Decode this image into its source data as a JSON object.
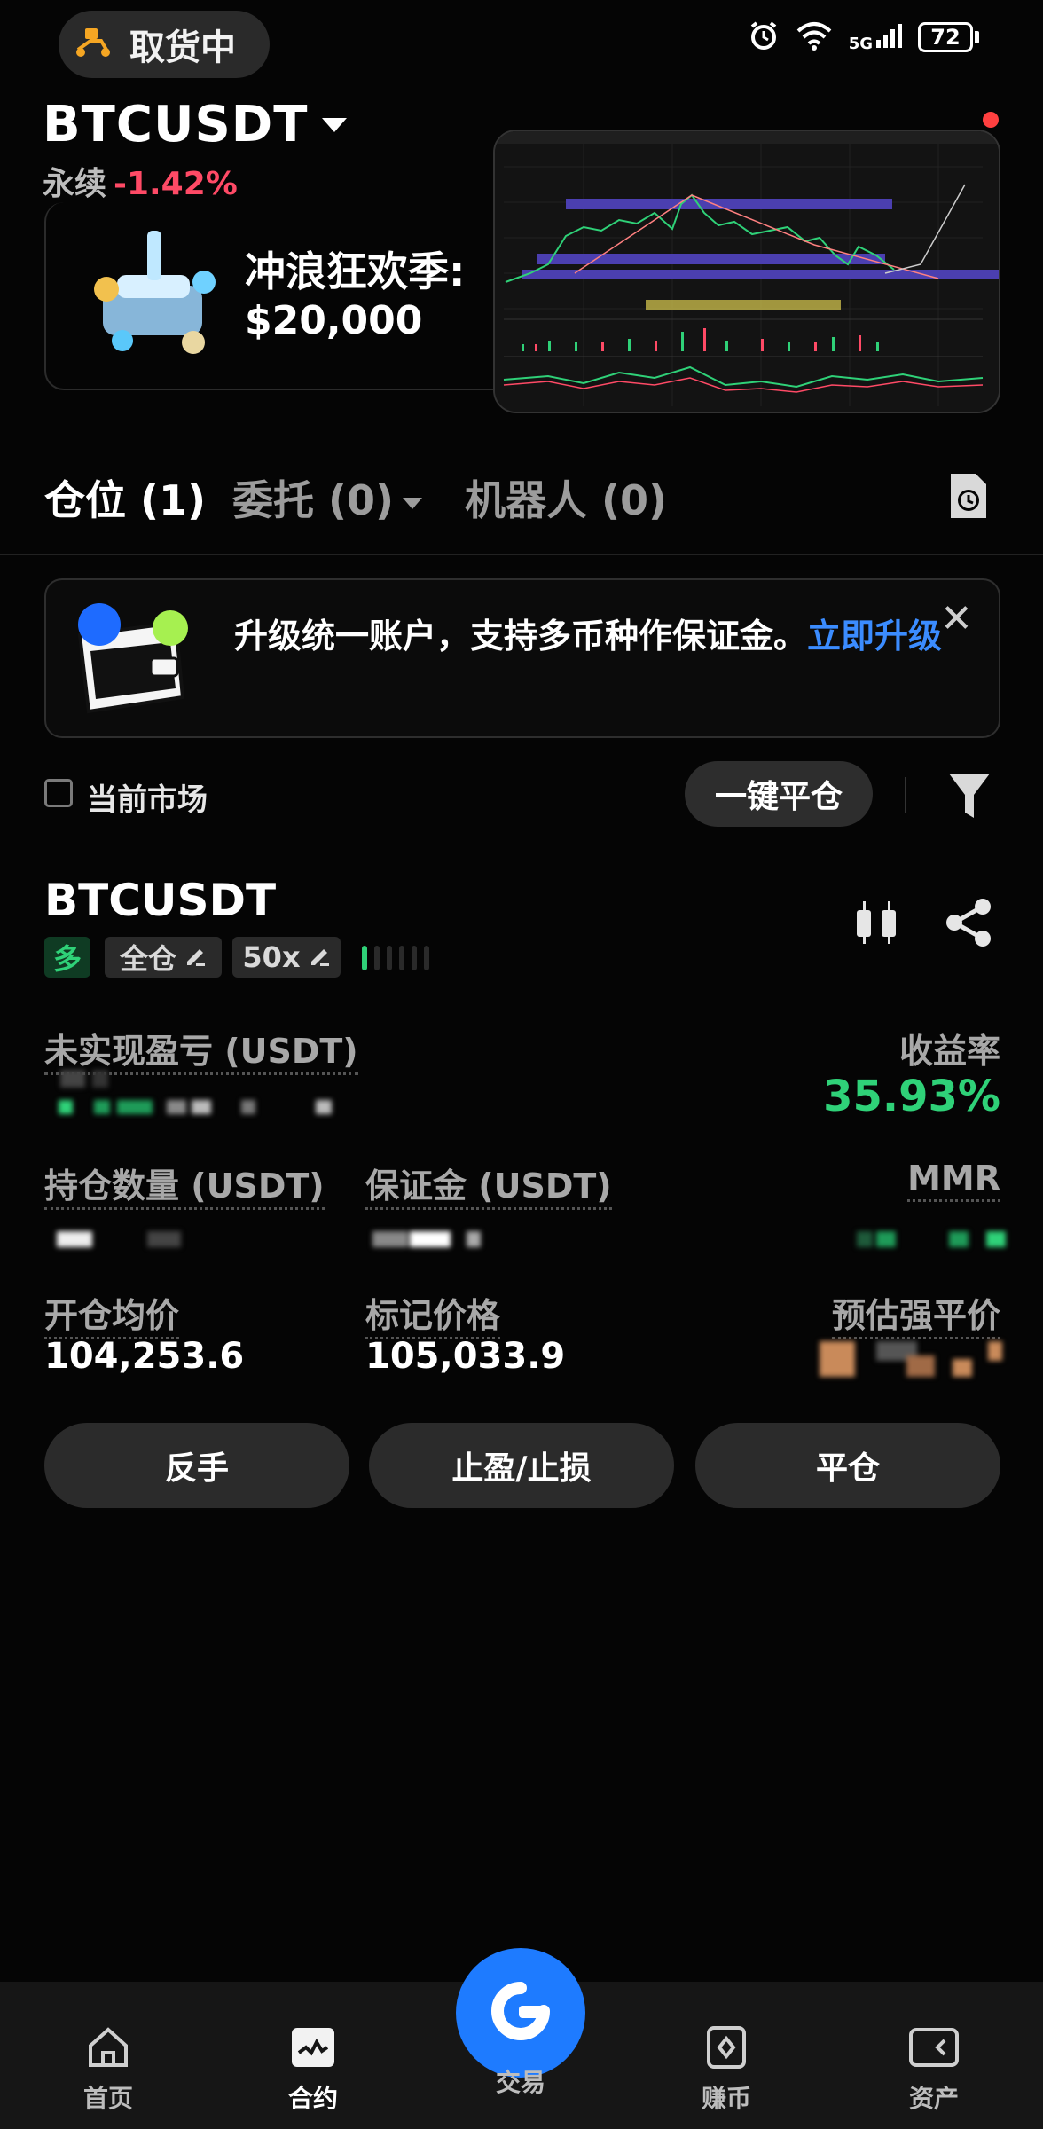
{
  "status_bar": {
    "pill_label": "取货中",
    "network": "5G",
    "battery": "72"
  },
  "header": {
    "symbol": "BTCUSDT",
    "contract_type": "永续",
    "change": "-1.42%"
  },
  "promo": {
    "title": "冲浪狂欢季:",
    "amount": "$20,000"
  },
  "tabs": [
    {
      "label": "仓位 (1)"
    },
    {
      "label": "委托 (0)"
    },
    {
      "label": "机器人 (0)"
    }
  ],
  "banner": {
    "text": "升级统一账户，支持多币种作保证金。",
    "link": "立即升级"
  },
  "filter": {
    "current_market": "当前市场",
    "close_all": "一键平仓"
  },
  "position": {
    "symbol": "BTCUSDT",
    "side": "多",
    "margin_mode": "全仓",
    "leverage": "50x",
    "unrealized_pnl_label": "未实现盈亏 (USDT)",
    "roi_label": "收益率",
    "roi_value": "35.93%",
    "size_label": "持仓数量 (USDT)",
    "margin_label": "保证金 (USDT)",
    "mmr_label": "MMR",
    "entry_label": "开仓均价",
    "entry_value": "104,253.6",
    "mark_label": "标记价格",
    "mark_value": "105,033.9",
    "liq_label": "预估强平价"
  },
  "actions": {
    "reverse": "反手",
    "tp_sl": "止盈/止损",
    "close": "平仓"
  },
  "nav": [
    {
      "label": "首页",
      "icon": "home-icon"
    },
    {
      "label": "合约",
      "icon": "contract-icon"
    },
    {
      "label": "交易",
      "icon": "trade-icon"
    },
    {
      "label": "赚币",
      "icon": "earn-icon"
    },
    {
      "label": "资产",
      "icon": "assets-icon"
    }
  ],
  "colors": {
    "up": "#2fd178",
    "down": "#ff4a66",
    "accent": "#1e7bff",
    "link": "#3b8cff"
  }
}
